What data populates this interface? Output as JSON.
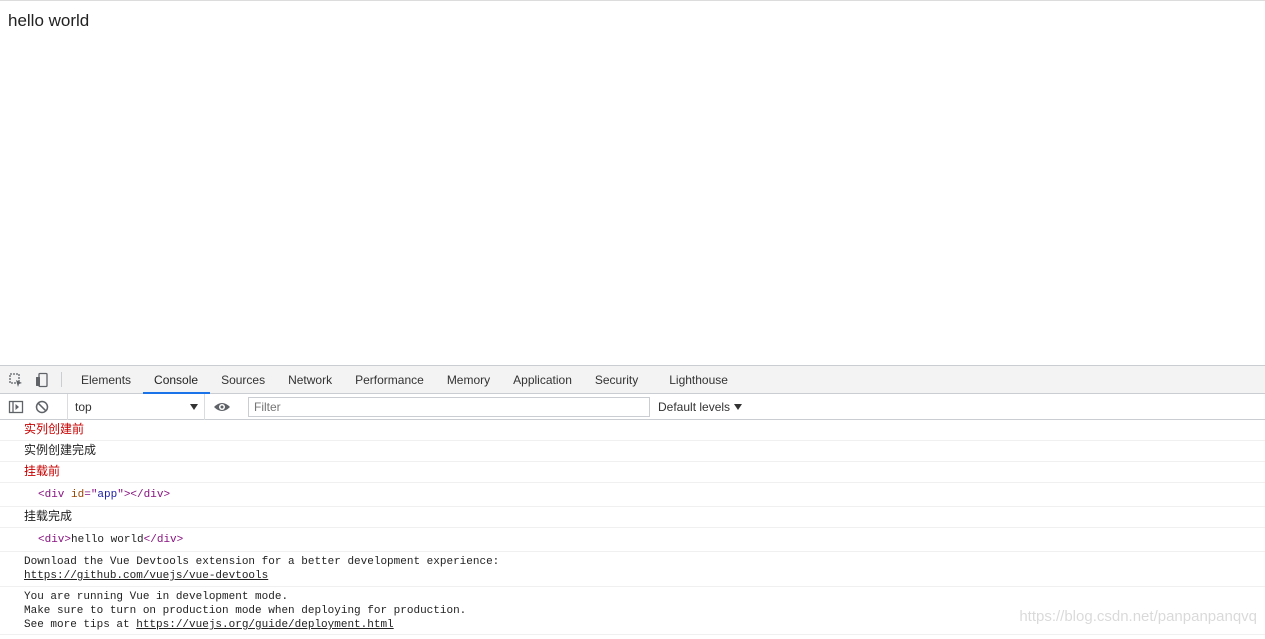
{
  "page": {
    "text": "hello world"
  },
  "devtools": {
    "tabs": [
      "Elements",
      "Console",
      "Sources",
      "Network",
      "Performance",
      "Memory",
      "Application",
      "Security",
      "Lighthouse"
    ],
    "active_tab": "Console",
    "toolbar": {
      "context": "top",
      "filter_placeholder": "Filter",
      "levels_label": "Default levels"
    },
    "console": {
      "m1": "实列创建前",
      "m2": "实例创建完成",
      "m3": "挂载前",
      "m4_open": "<div",
      "m4_attr": "id",
      "m4_eq": "=\"",
      "m4_val": "app",
      "m4_close": "\"></div>",
      "m5": "挂载完成",
      "m6_open": "<div>",
      "m6_text": "hello world",
      "m6_close": "</div>",
      "m7_text": "Download the Vue Devtools extension for a better development experience:",
      "m7_link": "https://github.com/vuejs/vue-devtools",
      "m8_line1": "You are running Vue in development mode.",
      "m8_line2": "Make sure to turn on production mode when deploying for production.",
      "m8_line3_prefix": "See more tips at ",
      "m8_link": "https://vuejs.org/guide/deployment.html",
      "prompt": "›"
    }
  },
  "watermark": "https://blog.csdn.net/panpanpanqvq"
}
